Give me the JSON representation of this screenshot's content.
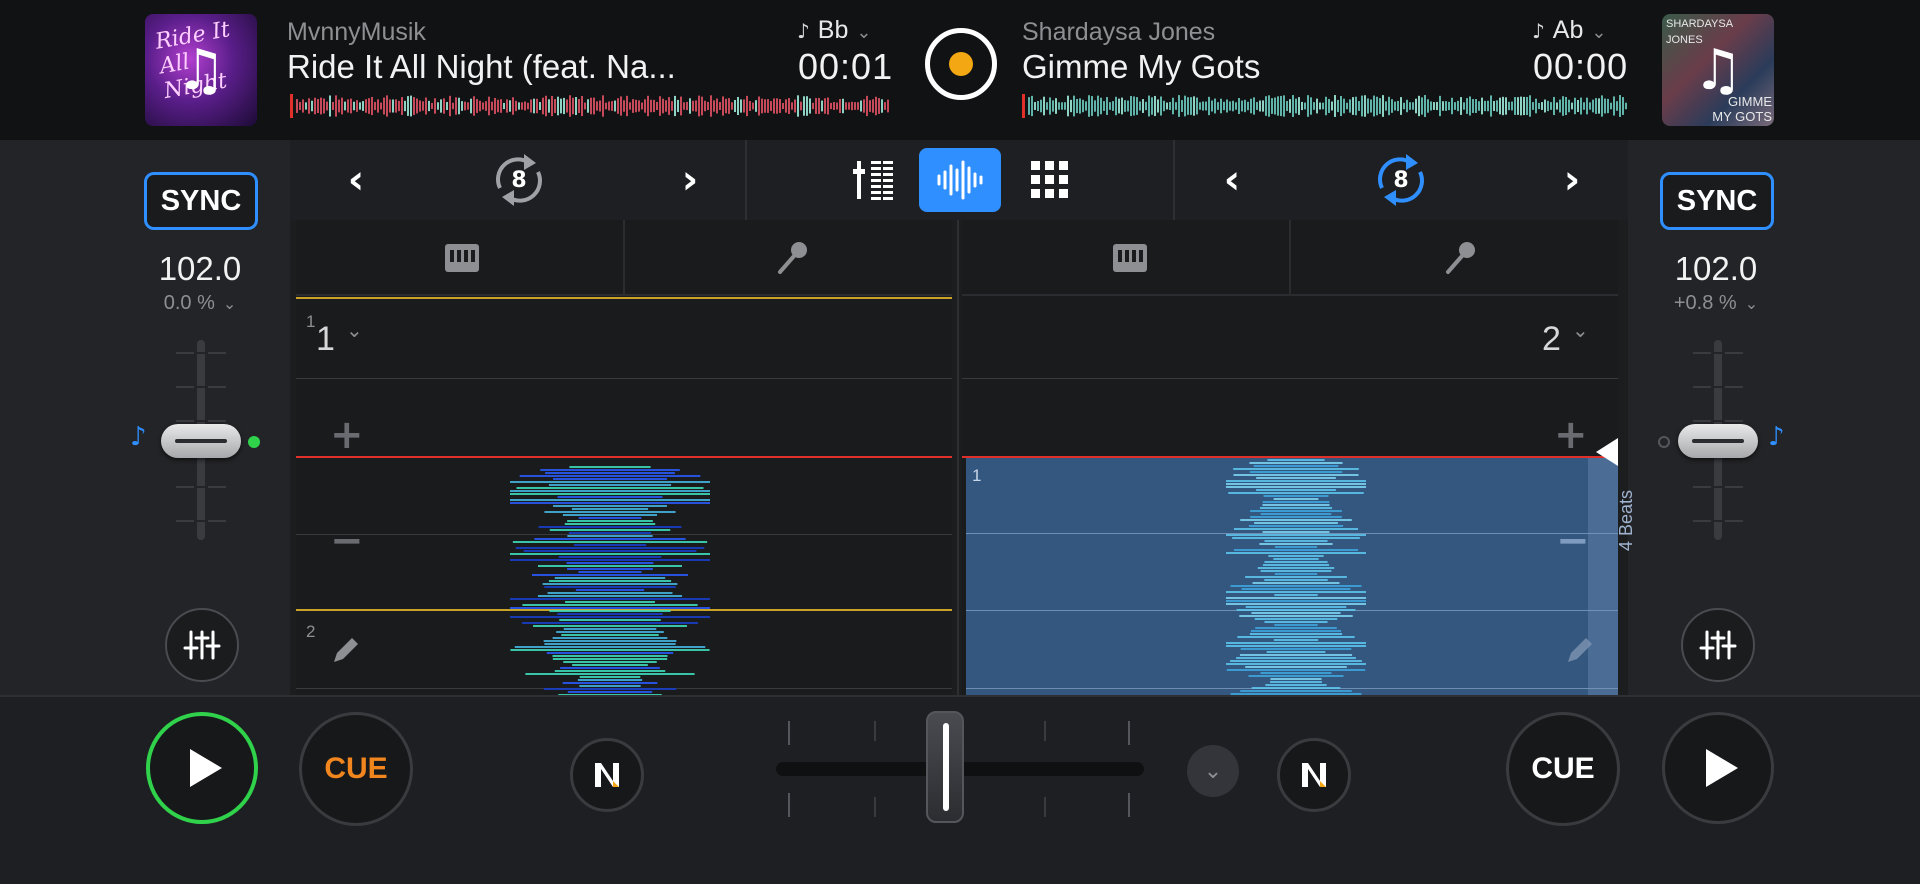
{
  "deck_left": {
    "artist": "MvnnyMusik",
    "title": "Ride It All Night (feat. Na...",
    "key": "Bb",
    "time": "00:01",
    "sync_label": "SYNC",
    "bpm": "102.0",
    "pitch": "0.0 %",
    "loop_size": "8",
    "pad_bank": "1",
    "pad_small_top": "1",
    "pad_small_bottom": "2",
    "cue_label": "CUE",
    "artwork_text": "Ride It All Night",
    "waveform_color": "#c74a5a",
    "artwork_icon": "music-note-icon"
  },
  "deck_right": {
    "artist": "Shardaysa Jones",
    "title": "Gimme My Gots",
    "key": "Ab",
    "time": "00:00",
    "sync_label": "SYNC",
    "bpm": "102.0",
    "pitch": "+0.8 %",
    "loop_size": "8",
    "pad_bank": "2",
    "pad_small_top": "1",
    "beats_label": "4 Beats",
    "cue_label": "CUE",
    "artwork_text_top": "SHARDAYSA JONES",
    "artwork_text_bottom": "GIMME MY GOTS",
    "waveform_color": "#5fb3a8",
    "artwork_icon": "music-note-icon"
  },
  "colors": {
    "accent_blue": "#2f8fff",
    "play_green": "#2fd24a",
    "cue_orange": "#f0861d",
    "record_dot": "#f3a712",
    "playhead_red": "#e0302a",
    "bar_yellow": "#c9a227"
  },
  "toolbar": {
    "left_prev": "‹",
    "left_next": "›",
    "right_prev": "‹",
    "right_next": "›",
    "views": [
      "mixer-view-icon",
      "waveform-view-icon",
      "pads-grid-icon"
    ],
    "active_view": "waveform-view-icon"
  },
  "crossfader": {
    "position": 0.5
  }
}
